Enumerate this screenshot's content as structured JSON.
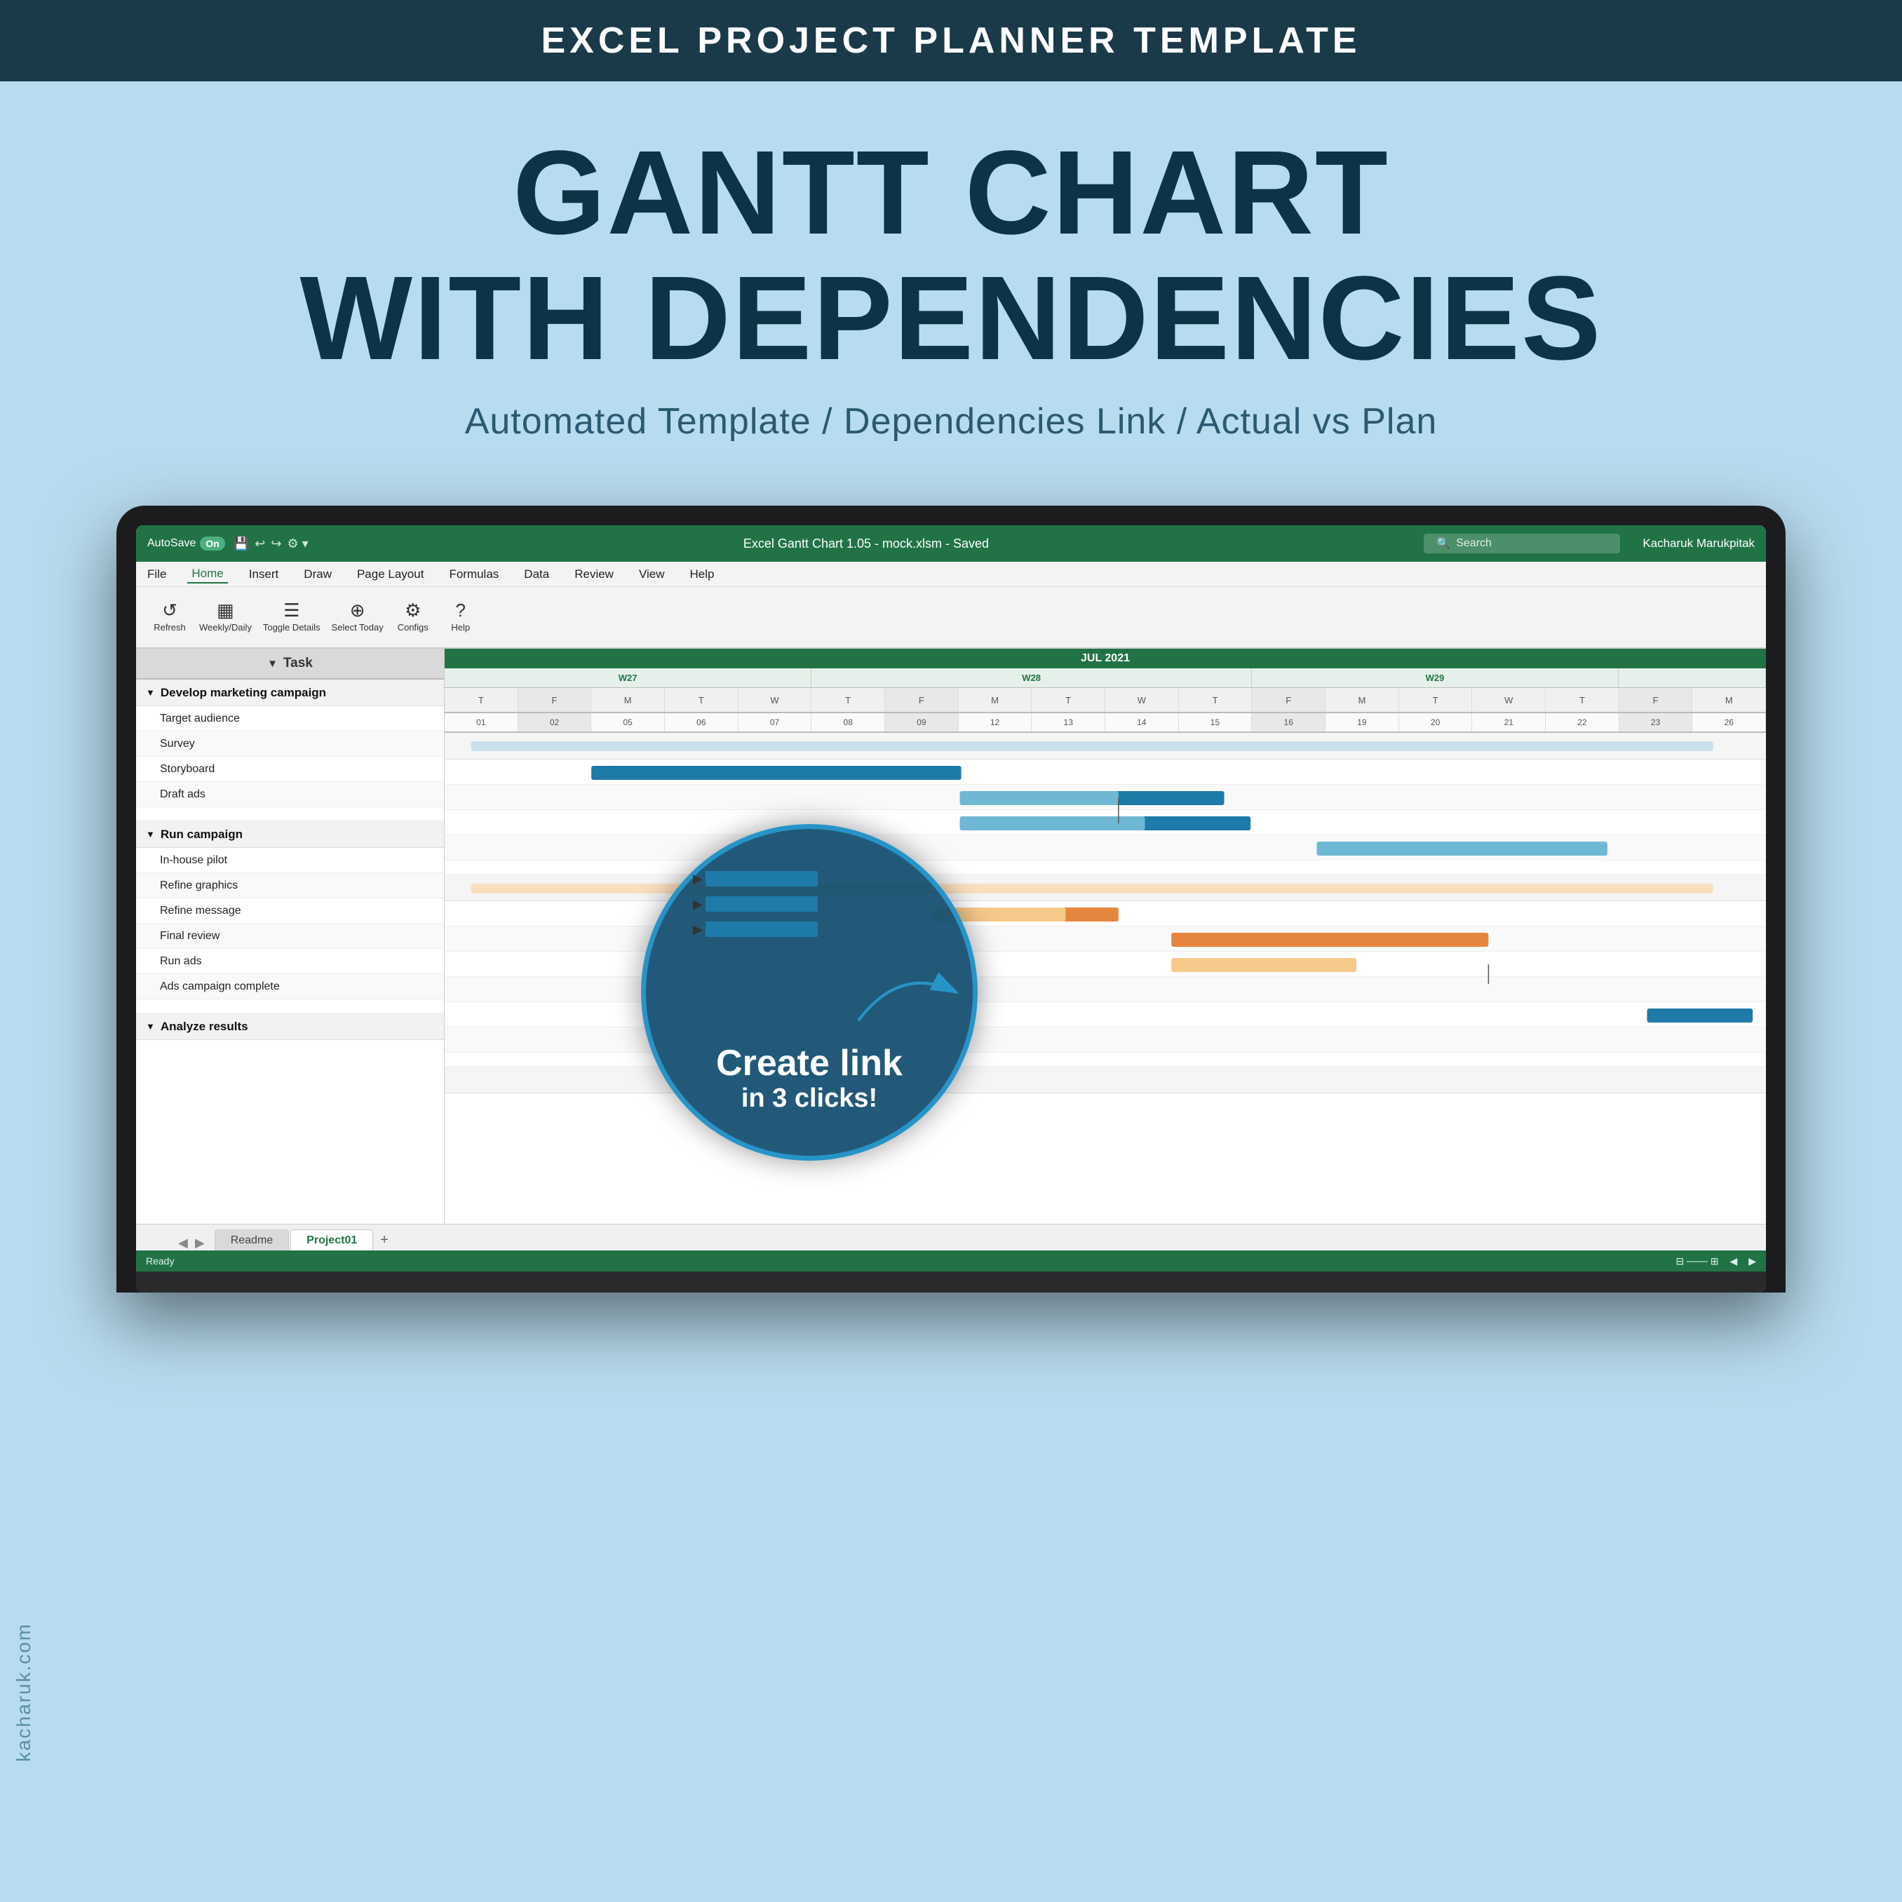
{
  "topBanner": {
    "text": "EXCEL PROJECT PLANNER TEMPLATE"
  },
  "titleArea": {
    "mainTitle": "GANTT CHART\nWITH DEPENDENCIES",
    "subtitle": "Automated Template / Dependencies Link / Actual vs Plan"
  },
  "excel": {
    "titlebar": {
      "autosave": "AutoSave",
      "autosaveState": "On",
      "filename": "Excel Gantt Chart 1.05 - mock.xlsm - Saved",
      "searchPlaceholder": "Search",
      "user": "Kacharuk Marukpitak"
    },
    "menubar": {
      "items": [
        "File",
        "Home",
        "Insert",
        "Draw",
        "Page Layout",
        "Formulas",
        "Data",
        "Review",
        "View",
        "Help"
      ]
    },
    "toolbar": {
      "buttons": [
        {
          "label": "Refresh",
          "icon": "↺"
        },
        {
          "label": "Weekly/Daily",
          "icon": "▦"
        },
        {
          "label": "Toggle Details",
          "icon": "☰"
        },
        {
          "label": "Select Today",
          "icon": "📍"
        },
        {
          "label": "Configs",
          "icon": "⚙"
        },
        {
          "label": "Help",
          "icon": "?"
        }
      ]
    },
    "sheet": {
      "taskHeader": "Task",
      "groups": [
        {
          "name": "Develop marketing campaign",
          "tasks": [
            "Target audience",
            "Survey",
            "Storyboard",
            "Draft ads"
          ]
        },
        {
          "name": "Run campaign",
          "tasks": [
            "In-house pilot",
            "Refine graphics",
            "Refine message",
            "Final review",
            "Run ads",
            "Ads campaign complete"
          ]
        },
        {
          "name": "Analyze results",
          "tasks": []
        }
      ]
    },
    "gantt": {
      "month": "JUL 2021",
      "weeks": [
        "W27",
        "W28",
        "W29"
      ],
      "days": [
        "T",
        "F",
        "M",
        "T",
        "W",
        "T",
        "F",
        "M",
        "T",
        "W",
        "T",
        "F",
        "M",
        "T",
        "W",
        "T",
        "F",
        "M"
      ],
      "dayNumbers": [
        "01",
        "02",
        "05",
        "06",
        "07",
        "08",
        "09",
        "12",
        "13",
        "14",
        "15",
        "16",
        "19",
        "20",
        "21",
        "22",
        "23",
        "26"
      ]
    },
    "tabs": {
      "items": [
        {
          "label": "Readme",
          "active": false
        },
        {
          "label": "Project01",
          "active": true
        }
      ]
    },
    "statusbar": {
      "left": "Ready",
      "right": ""
    }
  },
  "callout": {
    "line1": "Create link",
    "line2": "in 3 clicks!"
  },
  "sideText": "kacharuk.com"
}
